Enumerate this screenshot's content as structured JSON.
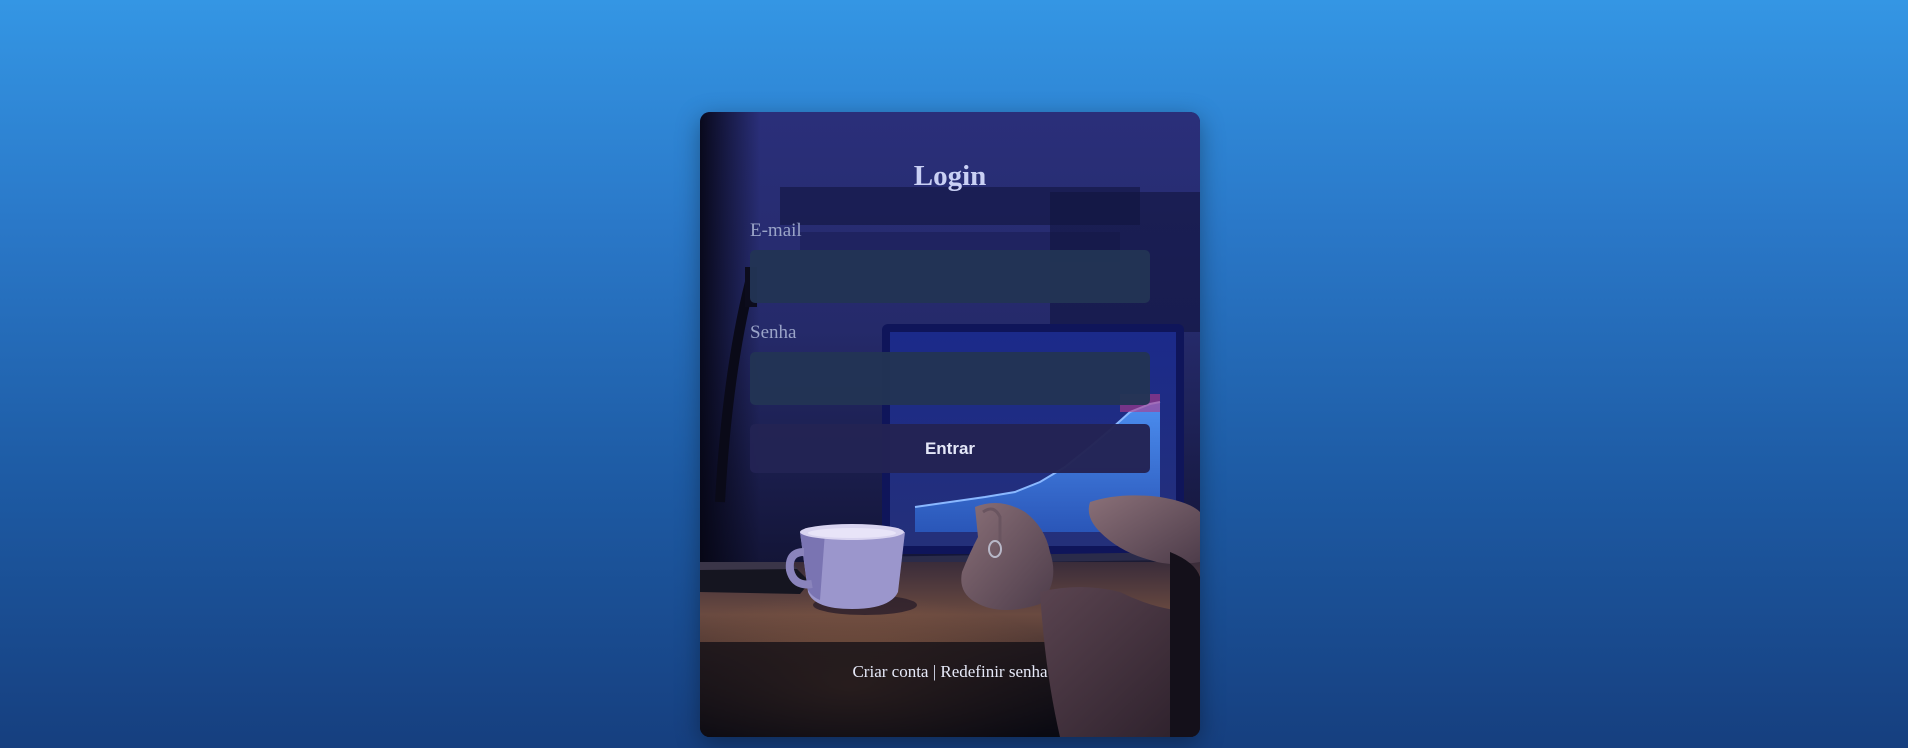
{
  "page": {
    "title": "Login"
  },
  "form": {
    "email_label": "E-mail",
    "email_value": "",
    "password_label": "Senha",
    "password_value": "",
    "submit_label": "Entrar"
  },
  "links": {
    "create_account": "Criar conta",
    "separator": "|",
    "reset_password": "Redefinir senha"
  },
  "colors": {
    "background_top": "#3496e4",
    "background_bottom": "#163f7f",
    "card_tint": "#1c1f55",
    "input_bg": "#223454",
    "button_bg": "#232354",
    "title_color": "#c9d0f4"
  },
  "background_image": {
    "depicts": "person typing on laptop with coffee cup on desk, dark blue ambience"
  }
}
